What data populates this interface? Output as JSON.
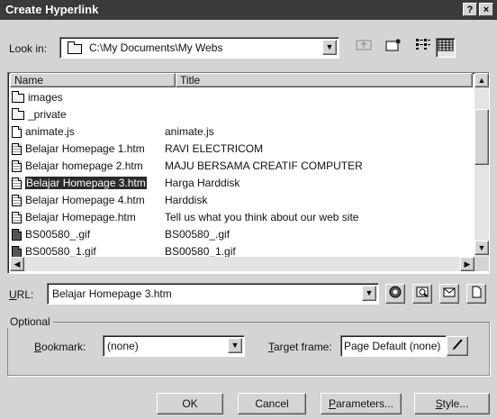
{
  "window": {
    "title": "Create Hyperlink",
    "help_button": "?",
    "close_button": "×"
  },
  "look_in": {
    "label": "Look in:",
    "path": "C:\\My Documents\\My Webs"
  },
  "file_list": {
    "columns": [
      "Name",
      "Title"
    ],
    "rows": [
      {
        "name": "images",
        "title": "",
        "icon": "folder-icon"
      },
      {
        "name": "_private",
        "title": "",
        "icon": "folder-icon"
      },
      {
        "name": "animate.js",
        "title": "animate.js",
        "icon": "file-icon"
      },
      {
        "name": "Belajar Homepage 1.htm",
        "title": "RAVI ELECTRICOM",
        "icon": "page-icon"
      },
      {
        "name": "Belajar homepage 2.htm",
        "title": "MAJU BERSAMA CREATIF COMPUTER",
        "icon": "page-icon"
      },
      {
        "name": "Belajar Homepage 3.htm",
        "title": "Harga Harddisk",
        "icon": "page-icon",
        "selected": true
      },
      {
        "name": "Belajar Homepage 4.htm",
        "title": "Harddisk",
        "icon": "page-icon"
      },
      {
        "name": "Belajar Homepage.htm",
        "title": "Tell us what you think about our web site",
        "icon": "page-icon"
      },
      {
        "name": "BS00580_.gif",
        "title": "BS00580_.gif",
        "icon": "gif-icon"
      },
      {
        "name": "BS00580_1.gif",
        "title": "BS00580_1.gif",
        "icon": "gif-icon"
      }
    ]
  },
  "url": {
    "label": "URL:",
    "value": "Belajar Homepage 3.htm"
  },
  "optional": {
    "group_label": "Optional",
    "bookmark_label": "Bookmark:",
    "bookmark_value": "(none)",
    "target_label": "Target frame:",
    "target_value": "Page Default (none)"
  },
  "buttons": {
    "ok": "OK",
    "cancel": "Cancel",
    "parameters": "Parameters...",
    "style": "Style..."
  },
  "colors": {
    "titlebar": "#3a3a3a",
    "face": "#d4d4d4",
    "selection": "#2a2a2a"
  }
}
